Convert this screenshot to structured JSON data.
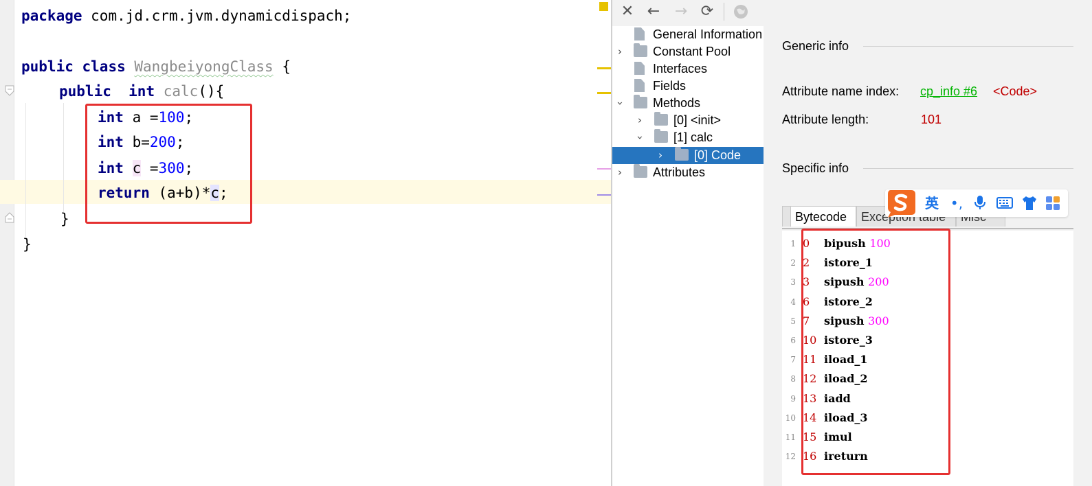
{
  "editor": {
    "code": {
      "line1": {
        "kw": "package",
        "rest": " com.jd.crm.jvm.dynamicdispach;"
      },
      "line3": {
        "kw1": "public",
        "kw2": "class",
        "classname": "WangbeiyongClass",
        "rest": " {"
      },
      "line4": {
        "kw1": "public",
        "kw2": "int",
        "method": "calc",
        "rest": "(){"
      },
      "line5": {
        "kw": "int",
        "rest": " a =",
        "num": "100",
        "end": ";"
      },
      "line6": {
        "kw": "int",
        "rest": " b=",
        "num": "200",
        "end": ";"
      },
      "line7": {
        "kw": "int",
        "var": "c",
        "rest": " =",
        "num": "300",
        "end": ";"
      },
      "line8": {
        "kw": "return",
        "rest": " (a+b)*",
        "var": "c",
        "end": ";"
      },
      "line9": "}",
      "line10": "}"
    }
  },
  "toolbar": {
    "icons": [
      "close-icon",
      "back-icon",
      "forward-icon",
      "refresh-icon",
      "web-icon"
    ]
  },
  "tree": {
    "general_info": "General Information",
    "constant_pool": "Constant Pool",
    "interfaces": "Interfaces",
    "fields": "Fields",
    "methods": "Methods",
    "method_init": "[0] <init>",
    "method_calc": "[1] calc",
    "code": "[0] Code",
    "attributes": "Attributes"
  },
  "detail": {
    "generic_info_title": "Generic info",
    "attr_name_index_label": "Attribute name index:",
    "attr_name_index_link": "cp_info #6",
    "attr_name_index_value": "<Code>",
    "attr_length_label": "Attribute length:",
    "attr_length_value": "101",
    "specific_info_title": "Specific info",
    "tabs": [
      "Bytecode",
      "Exception table",
      "Misc"
    ]
  },
  "bytecode": [
    {
      "ln": "1",
      "off": "0",
      "op": "bipush",
      "arg": "100"
    },
    {
      "ln": "2",
      "off": "2",
      "op": "istore_1",
      "arg": ""
    },
    {
      "ln": "3",
      "off": "3",
      "op": "sipush",
      "arg": "200"
    },
    {
      "ln": "4",
      "off": "6",
      "op": "istore_2",
      "arg": ""
    },
    {
      "ln": "5",
      "off": "7",
      "op": "sipush",
      "arg": "300"
    },
    {
      "ln": "6",
      "off": "10",
      "op": "istore_3",
      "arg": ""
    },
    {
      "ln": "7",
      "off": "11",
      "op": "iload_1",
      "arg": ""
    },
    {
      "ln": "8",
      "off": "12",
      "op": "iload_2",
      "arg": ""
    },
    {
      "ln": "9",
      "off": "13",
      "op": "iadd",
      "arg": ""
    },
    {
      "ln": "10",
      "off": "14",
      "op": "iload_3",
      "arg": ""
    },
    {
      "ln": "11",
      "off": "15",
      "op": "imul",
      "arg": ""
    },
    {
      "ln": "12",
      "off": "16",
      "op": "ireturn",
      "arg": ""
    }
  ],
  "ime": {
    "lang": "英",
    "punct": "•,"
  },
  "colors": {
    "keyword": "#000080",
    "number": "#0000ff",
    "selection": "#2675bf",
    "annotation_box": "#e53030",
    "link": "#00b400",
    "offset": "#c00000",
    "bytecode_arg": "#ff00ff"
  }
}
